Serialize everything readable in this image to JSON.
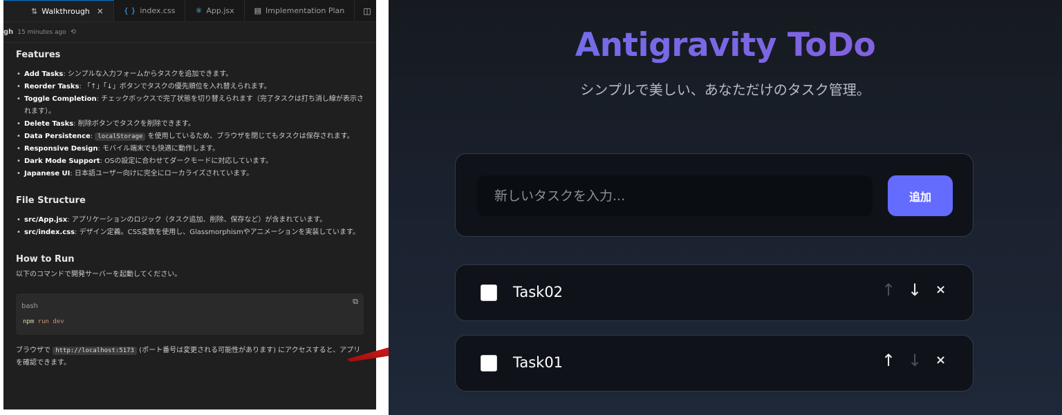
{
  "editor": {
    "tabs": [
      {
        "label": "Walkthrough",
        "active": true
      },
      {
        "label": "index.css"
      },
      {
        "label": "App.jsx"
      },
      {
        "label": "Implementation Plan"
      }
    ],
    "meta": {
      "crumb": "gh",
      "time": "15 minutes ago"
    },
    "features": {
      "heading": "Features",
      "items": [
        {
          "title": "Add Tasks",
          "text": ": シンプルな入力フォームからタスクを追加できます。"
        },
        {
          "title": "Reorder Tasks",
          "text": ": 「↑」「↓」ボタンでタスクの優先順位を入れ替えられます。"
        },
        {
          "title": "Toggle Completion",
          "text": ": チェックボックスで完了状態を切り替えられます（完了タスクは打ち消し線が表示されます）。"
        },
        {
          "title": "Delete Tasks",
          "text": ": 削除ボタンでタスクを削除できます。"
        },
        {
          "title": "Data Persistence",
          "text_before": ": ",
          "code": "localStorage",
          "text_after": " を使用しているため、ブラウザを閉じてもタスクは保存されます。"
        },
        {
          "title": "Responsive Design",
          "text": ": モバイル端末でも快適に動作します。"
        },
        {
          "title": "Dark Mode Support",
          "text": ": OSの設定に合わせてダークモードに対応しています。"
        },
        {
          "title": "Japanese UI",
          "text": ": 日本語ユーザー向けに完全にローカライズされています。"
        }
      ]
    },
    "structure": {
      "heading": "File Structure",
      "items": [
        {
          "title": "src/App.jsx",
          "text": ": アプリケーションのロジック（タスク追加、削除、保存など）が含まれています。"
        },
        {
          "title": "src/index.css",
          "text": ": デザイン定義。CSS変数を使用し、Glassmorphismやアニメーションを実装しています。"
        }
      ]
    },
    "run": {
      "heading": "How to Run",
      "intro": "以下のコマンドで開発サーバーを起動してください。",
      "code_lang": "bash",
      "cmd_1": "npm",
      "cmd_2": " run dev",
      "outro_before": "ブラウザで ",
      "outro_code": "http://localhost:5173",
      "outro_after": " (ポート番号は変更される可能性があります) にアクセスすると、アプリを確認できます。"
    }
  },
  "app": {
    "title": "Antigravity ToDo",
    "subtitle": "シンプルで美しい、あなただけのタスク管理。",
    "input_placeholder": "新しいタスクを入力...",
    "add_label": "追加",
    "tasks": [
      {
        "text": "Task02",
        "done": false,
        "up_enabled": false,
        "down_enabled": true
      },
      {
        "text": "Task01",
        "done": false,
        "up_enabled": true,
        "down_enabled": false
      }
    ],
    "up_icon": "↑",
    "down_icon": "↓",
    "delete_icon": "×",
    "colors": {
      "accent": "#646cff",
      "title_start": "#6b72f0",
      "title_end": "#8a5cd8"
    }
  }
}
